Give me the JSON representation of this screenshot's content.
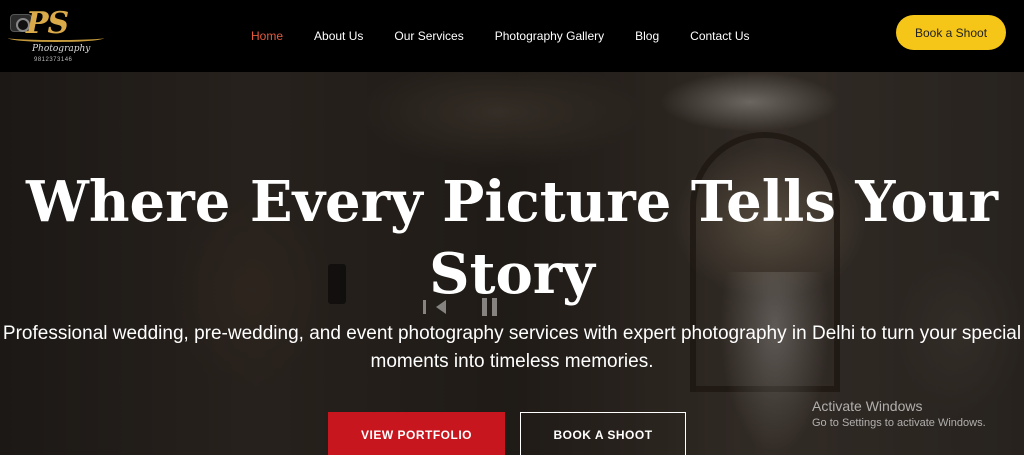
{
  "logo": {
    "brand": "PS",
    "tagline": "Photography",
    "phone": "9812373146"
  },
  "nav": {
    "items": [
      {
        "label": "Home",
        "active": true
      },
      {
        "label": "About Us",
        "active": false
      },
      {
        "label": "Our Services",
        "active": false
      },
      {
        "label": "Photography Gallery",
        "active": false
      },
      {
        "label": "Blog",
        "active": false
      },
      {
        "label": "Contact Us",
        "active": false
      }
    ]
  },
  "header": {
    "cta_label": "Book a Shoot"
  },
  "hero": {
    "title": "Where Every Picture Tells Your Story",
    "subtitle": "Professional wedding, pre-wedding, and event photography services with expert photography in Delhi to turn your special moments into timeless memories.",
    "primary_button": "VIEW PORTFOLIO",
    "secondary_button": "BOOK A SHOOT"
  },
  "watermark": {
    "line1": "Activate Windows",
    "line2": "Go to Settings to activate Windows."
  },
  "colors": {
    "accent_nav_active": "#e35b3f",
    "cta_yellow": "#f5c518",
    "primary_red": "#c8161f",
    "logo_gold": "#d9a94a"
  },
  "icons": [
    "camera-icon",
    "previous-icon",
    "pause-icon"
  ]
}
